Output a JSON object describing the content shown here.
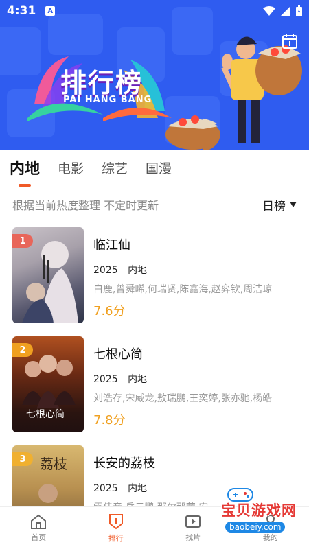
{
  "status_bar": {
    "time": "4:31",
    "notification": "A"
  },
  "banner": {
    "title": "排行榜",
    "subtitle": "PAI HANG BANG"
  },
  "tabs": [
    {
      "label": "内地",
      "active": true
    },
    {
      "label": "电影",
      "active": false
    },
    {
      "label": "综艺",
      "active": false
    },
    {
      "label": "国漫",
      "active": false
    }
  ],
  "subhead": {
    "note": "根据当前热度整理 不定时更新",
    "rank_select": "日榜"
  },
  "items": [
    {
      "rank": "1",
      "title": "临江仙",
      "year": "2025",
      "region": "内地",
      "cast": "白鹿,曾舜晞,何瑞贤,陈鑫海,赵弈钦,周洁琼",
      "score": "7.6分",
      "badge_color": "#e8665a"
    },
    {
      "rank": "2",
      "title": "七根心简",
      "year": "2025",
      "region": "内地",
      "cast": "刘浩存,宋威龙,敖瑞鹏,王奕婷,张亦驰,杨皓",
      "score": "7.8分",
      "badge_color": "#f0a020"
    },
    {
      "rank": "3",
      "title": "长安的荔枝",
      "year": "2025",
      "region": "内地",
      "cast": "雷佳音,岳云鹏,那尔那茜,安",
      "score": "",
      "badge_color": "#f0b030"
    }
  ],
  "bottom_nav": [
    {
      "label": "首页",
      "active": false
    },
    {
      "label": "排行",
      "active": true
    },
    {
      "label": "找片",
      "active": false
    },
    {
      "label": "我的",
      "active": false
    }
  ],
  "watermark": {
    "text": "宝贝游戏网",
    "url": "baobeiy.com"
  },
  "colors": {
    "accent": "#f05a28",
    "banner_bg": "#2f5cf0",
    "score": "#f0a020"
  }
}
